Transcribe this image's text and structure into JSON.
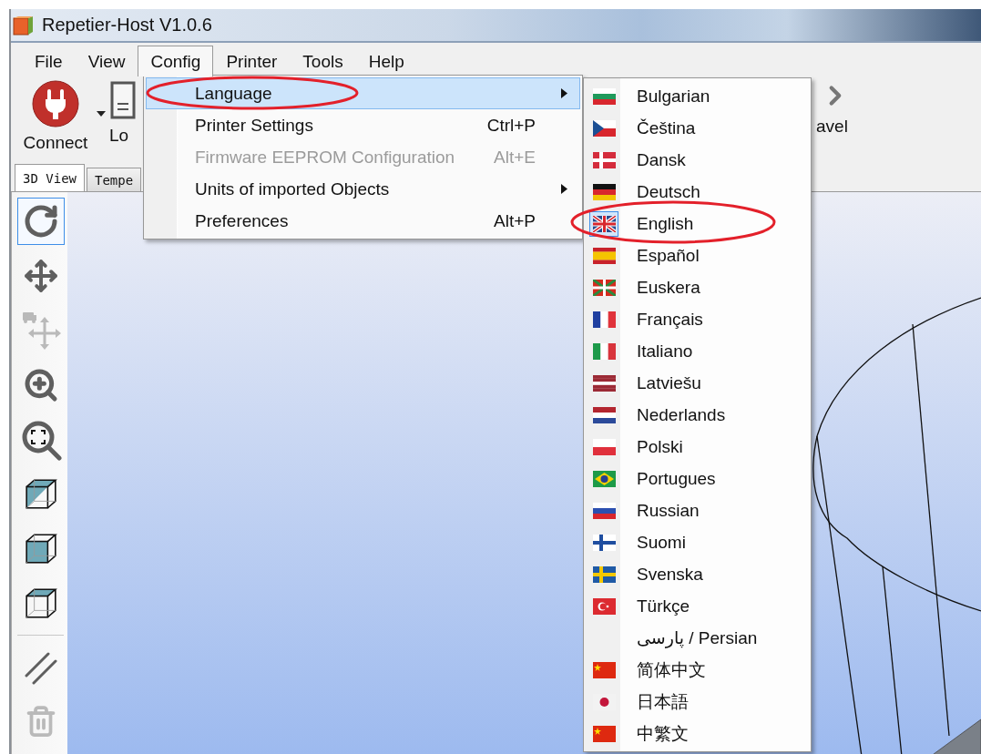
{
  "window": {
    "title": "Repetier-Host V1.0.6"
  },
  "menu_bar": [
    {
      "label": "File",
      "selected": false
    },
    {
      "label": "View",
      "selected": false
    },
    {
      "label": "Config",
      "selected": true
    },
    {
      "label": "Printer",
      "selected": false
    },
    {
      "label": "Tools",
      "selected": false
    },
    {
      "label": "Help",
      "selected": false
    }
  ],
  "toolbar": [
    {
      "kind": "connect",
      "label": "Connect"
    },
    {
      "kind": "load",
      "label": "Lo"
    },
    {
      "kind": "travel",
      "label": "avel"
    }
  ],
  "tabs": [
    {
      "label": "3D View",
      "selected": true
    },
    {
      "label": "Tempe",
      "selected": false
    }
  ],
  "view_tools": [
    {
      "kind": "rotate",
      "selected": true,
      "disabled": false
    },
    {
      "kind": "move",
      "selected": false,
      "disabled": false
    },
    {
      "kind": "move_object",
      "selected": false,
      "disabled": true
    },
    {
      "kind": "zoom_in",
      "selected": false,
      "disabled": false
    },
    {
      "kind": "zoom_fit",
      "selected": false,
      "disabled": false
    },
    {
      "kind": "cube_diagonal",
      "selected": false,
      "disabled": false
    },
    {
      "kind": "cube_front",
      "selected": false,
      "disabled": false
    },
    {
      "kind": "cube_top",
      "selected": false,
      "disabled": false
    }
  ],
  "edit_tools": [
    {
      "kind": "parallel",
      "disabled": false
    },
    {
      "kind": "trash",
      "disabled": true
    }
  ],
  "config_menu": {
    "items": [
      {
        "label": "Language",
        "selected": true,
        "disabled": false,
        "submenu": true
      },
      {
        "label": "Printer Settings",
        "shortcut": "Ctrl+P",
        "selected": false,
        "disabled": false,
        "submenu": false
      },
      {
        "label": "Firmware EEPROM Configuration",
        "shortcut": "Alt+E",
        "selected": false,
        "disabled": true,
        "submenu": false
      },
      {
        "label": "Units of imported Objects",
        "selected": false,
        "disabled": false,
        "submenu": true
      },
      {
        "label": "Preferences",
        "shortcut": "Alt+P",
        "selected": false,
        "disabled": false,
        "submenu": false
      }
    ]
  },
  "language_menu": {
    "items": [
      {
        "label": "Bulgarian",
        "checked": false
      },
      {
        "label": "Čeština",
        "checked": false
      },
      {
        "label": "Dansk",
        "checked": false
      },
      {
        "label": "Deutsch",
        "checked": false
      },
      {
        "label": "English",
        "checked": true
      },
      {
        "label": "Español",
        "checked": false
      },
      {
        "label": "Euskera",
        "checked": false
      },
      {
        "label": "Français",
        "checked": false
      },
      {
        "label": "Italiano",
        "checked": false
      },
      {
        "label": "Latviešu",
        "checked": false
      },
      {
        "label": "Nederlands",
        "checked": false
      },
      {
        "label": "Polski",
        "checked": false
      },
      {
        "label": "Portugues",
        "checked": false
      },
      {
        "label": "Russian",
        "checked": false
      },
      {
        "label": "Suomi",
        "checked": false
      },
      {
        "label": "Svenska",
        "checked": false
      },
      {
        "label": "Türkçe",
        "checked": false
      },
      {
        "label": "پارسی / Persian",
        "checked": false
      },
      {
        "label": "简体中文",
        "checked": false
      },
      {
        "label": "日本語",
        "checked": false
      },
      {
        "label": "中繁文",
        "checked": false
      }
    ]
  }
}
